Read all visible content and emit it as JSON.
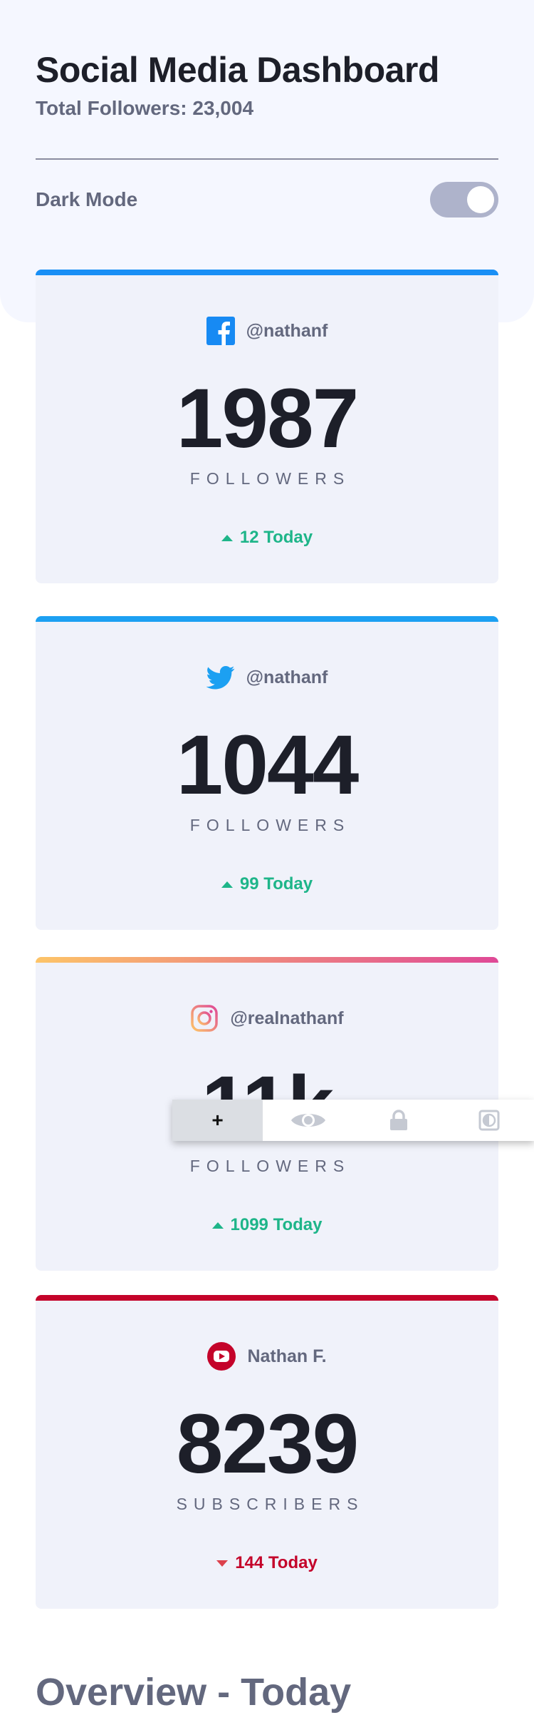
{
  "header": {
    "title": "Social Media Dashboard",
    "total_followers": "Total Followers: 23,004",
    "dark_mode_label": "Dark Mode",
    "dark_mode_on": true
  },
  "cards": [
    {
      "platform": "facebook",
      "icon": "facebook-icon",
      "accent": "#198ff5",
      "handle": "@nathanf",
      "count": "1987",
      "unit": "FOLLOWERS",
      "trend": "up",
      "today": "12 Today"
    },
    {
      "platform": "twitter",
      "icon": "twitter-icon",
      "accent": "#1ca0f2",
      "handle": "@nathanf",
      "count": "1044",
      "unit": "FOLLOWERS",
      "trend": "up",
      "today": "99 Today"
    },
    {
      "platform": "instagram",
      "icon": "instagram-icon",
      "accent": "#df4996",
      "handle": "@realnathanf",
      "count": "11k",
      "unit": "FOLLOWERS",
      "trend": "up",
      "today": "1099 Today"
    },
    {
      "platform": "youtube",
      "icon": "youtube-icon",
      "accent": "#c4032a",
      "handle": "Nathan F.",
      "count": "8239",
      "unit": "SUBSCRIBERS",
      "trend": "down",
      "today": "144 Today"
    }
  ],
  "colors": {
    "up": "#1eb589",
    "down": "#c4032a"
  },
  "toolbar": {
    "items": [
      "plus-icon",
      "eye-icon",
      "lock-icon",
      "contrast-icon"
    ],
    "plus_label": "+"
  },
  "overview": {
    "title": "Overview - Today"
  }
}
